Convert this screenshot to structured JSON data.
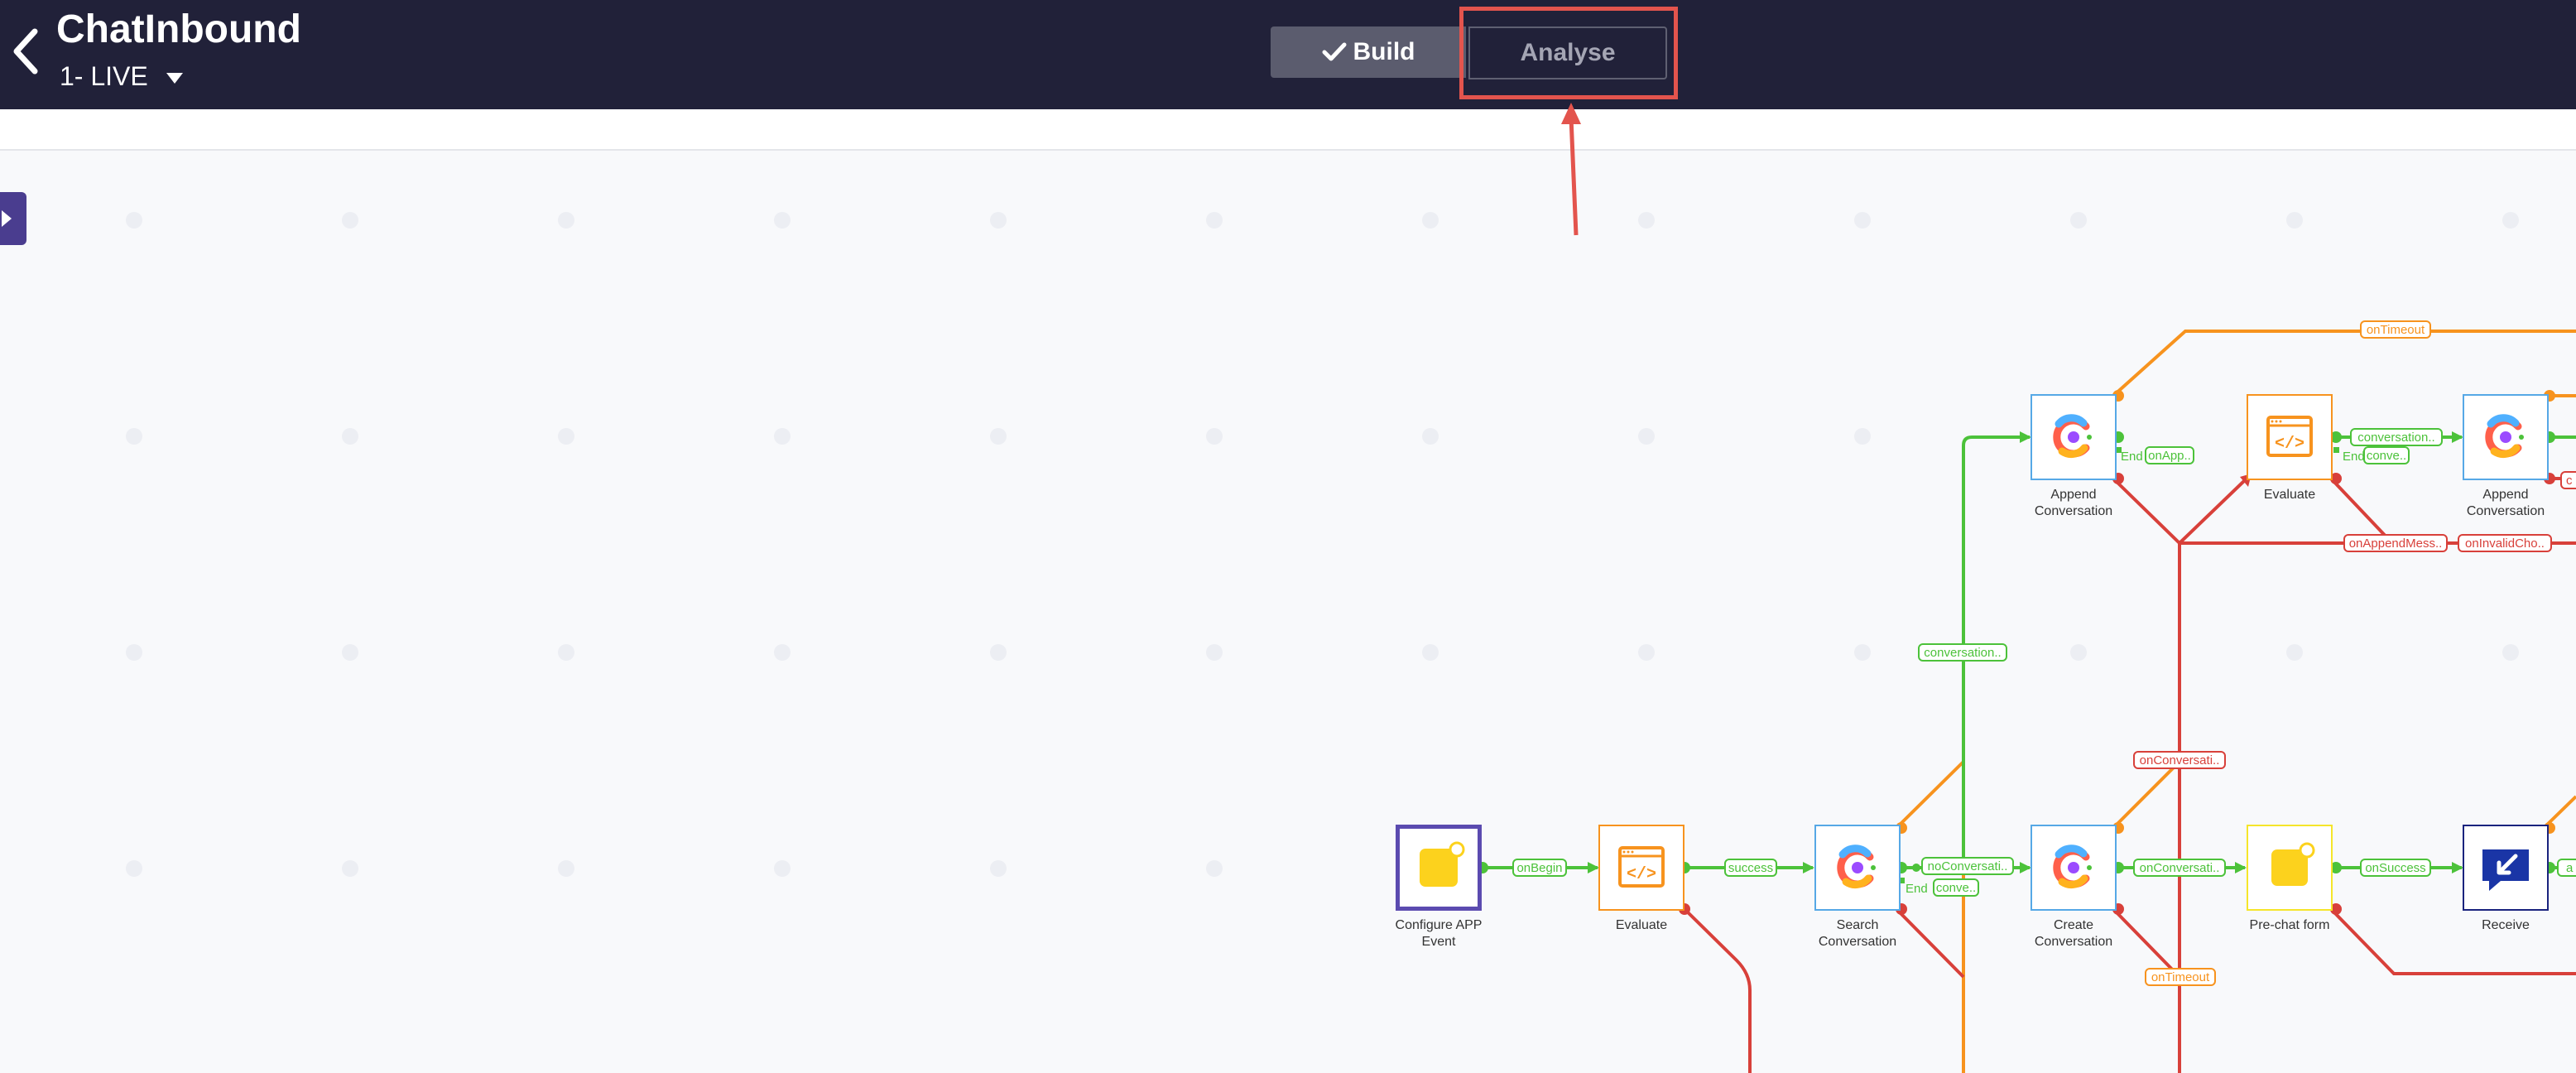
{
  "header": {
    "title": "ChatInbound",
    "version": "1- LIVE",
    "tabs": [
      {
        "label": "Build",
        "active": true
      },
      {
        "label": "Analyse",
        "active": false
      }
    ]
  },
  "colors": {
    "header_bg": "#212139",
    "success": "#4cc23a",
    "failure": "#d8403a",
    "timeout": "#f7931e",
    "highlight": "#e3544d",
    "accent": "#4a3d8f"
  },
  "nodes": {
    "configure_app_event": {
      "line1": "Configure APP",
      "line2": "Event",
      "icon": "app-event-icon"
    },
    "evaluate_1": {
      "label": "Evaluate",
      "icon": "code-evaluate-icon"
    },
    "search_conversation": {
      "line1": "Search",
      "line2": "Conversation",
      "icon": "conversation-icon"
    },
    "create_conversation": {
      "line1": "Create",
      "line2": "Conversation",
      "icon": "conversation-icon"
    },
    "pre_chat_form": {
      "label": "Pre-chat form",
      "icon": "form-icon"
    },
    "receive": {
      "label": "Receive",
      "icon": "receive-message-icon"
    },
    "append_conversation_1": {
      "line1": "Append",
      "line2": "Conversation",
      "icon": "conversation-icon"
    },
    "evaluate_2": {
      "label": "Evaluate",
      "icon": "code-evaluate-icon"
    },
    "append_conversation_2": {
      "line1": "Append",
      "line2": "Conversation",
      "icon": "conversation-icon"
    }
  },
  "edges": {
    "on_begin": "onBegin",
    "success": "success",
    "no_conversation": "noConversati..",
    "on_conversation_1": "onConversati..",
    "on_success": "onSuccess",
    "on_timeout_top": "onTimeout",
    "on_timeout_bottom": "onTimeout",
    "conversation_vertical": "conversation..",
    "on_conversation_red": "onConversati..",
    "on_app": "onApp..",
    "end_1": "End",
    "end_2": "End",
    "end_3": "End",
    "conve_1": "conve..",
    "conve_2": "conve..",
    "conversation_right": "conversation..",
    "on_append_mess": "onAppendMess..",
    "on_invalid_cho": "onInvalidCho..",
    "receive_out": "a",
    "append2_red_out": "c"
  }
}
